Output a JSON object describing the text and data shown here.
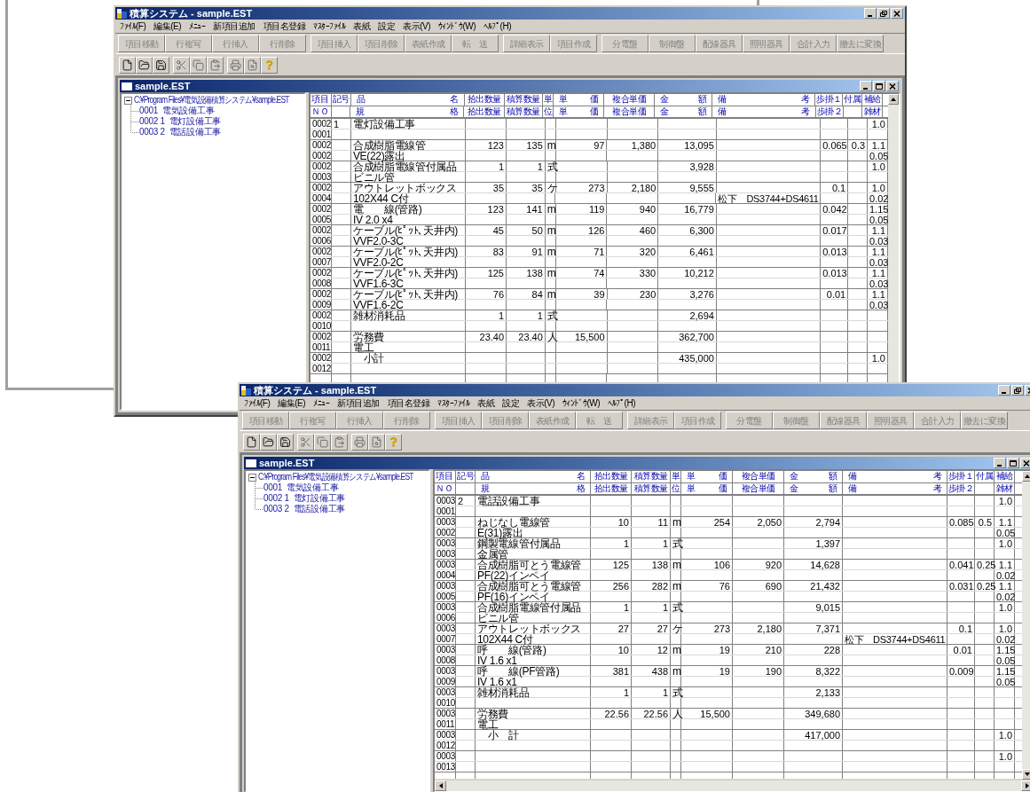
{
  "windows": [
    {
      "title": "積算システム - sample.EST",
      "menu": [
        "ﾌｧｲﾙ(F)",
        "編集(E)",
        "ﾒﾆｭｰ",
        "新項目追加",
        "項目名登録",
        "ﾏｽﾀｰﾌｧｲﾙ",
        "表紙",
        "設定",
        "表示(V)",
        "ｳｨﾝﾄﾞｳ(W)",
        "ﾍﾙﾌﾟ(H)"
      ],
      "toolbar_groups": [
        [
          {
            "label": "項目移動",
            "disabled": true
          },
          {
            "label": "行複写",
            "disabled": true
          },
          {
            "label": "行挿入",
            "disabled": true
          },
          {
            "label": "行削除",
            "disabled": true
          }
        ],
        [
          {
            "label": "項目挿入",
            "disabled": true
          },
          {
            "label": "項目削除",
            "disabled": true
          },
          {
            "label": "表紙作成",
            "disabled": true
          },
          {
            "label": "転　送",
            "disabled": true
          }
        ],
        [
          {
            "label": "詳細表示",
            "disabled": true
          },
          {
            "label": "項目作成",
            "disabled": true
          }
        ],
        [
          {
            "label": "分電盤",
            "disabled": true
          },
          {
            "label": "制御盤",
            "disabled": true
          },
          {
            "label": "配線器具",
            "disabled": true
          },
          {
            "label": "照明器具",
            "disabled": true
          },
          {
            "label": "合計入力",
            "disabled": true
          },
          {
            "label": "撤去に変換",
            "disabled": true
          }
        ]
      ],
      "child": {
        "title": "sample.EST",
        "tree": {
          "label": "C:¥Program Files¥電気設備積算システム¥sample.EST",
          "expanded": true,
          "children": [
            {
              "code": "0001",
              "label": "電気設備工事"
            },
            {
              "code": "0002 1",
              "label": "電灯設備工事"
            },
            {
              "code": "0003 2",
              "label": "電話設備工事"
            }
          ]
        },
        "table": {
          "columns": [
            {
              "top": [
                "項目"
              ],
              "bottom": [
                "ＮＯ"
              ]
            },
            {
              "top": [
                "記号"
              ]
            },
            {
              "top": [
                "品",
                "名"
              ],
              "bottom": [
                "規",
                "格"
              ]
            },
            {
              "top": [
                "拾出数量"
              ],
              "bottom": [
                "拾出数量"
              ]
            },
            {
              "top": [
                "積算数量"
              ],
              "bottom": [
                "積算数量"
              ]
            },
            {
              "top": [
                "単"
              ],
              "bottom": [
                "位"
              ]
            },
            {
              "top": [
                "単",
                "価"
              ],
              "bottom": [
                "単",
                "価"
              ]
            },
            {
              "top": [
                "複合単価"
              ],
              "bottom": [
                "複合単価"
              ]
            },
            {
              "top": [
                "金",
                "額"
              ],
              "bottom": [
                "金",
                "額"
              ]
            },
            {
              "top": [
                "備",
                "考"
              ],
              "bottom": [
                "備",
                "考"
              ]
            },
            {
              "top": [
                "歩掛１"
              ],
              "bottom": [
                "歩掛２"
              ]
            },
            {
              "top": [
                "付属"
              ]
            },
            {
              "top": [
                "補給"
              ],
              "bottom": [
                "雑材"
              ]
            }
          ],
          "rows": [
            {
              "no": "0002",
              "mark": "1",
              "name": "電灯設備工事",
              "supply": "1.0"
            },
            {
              "no": "0001"
            },
            {
              "no": "0002",
              "name": "合成樹脂電線管",
              "qty_takeoff": "123",
              "qty_estimate": "135",
              "unit": "m",
              "unit_price": "97",
              "compound_price": "1,380",
              "amount": "13,095",
              "labor": "0.065",
              "accessory": "0.3",
              "supply": "1.1"
            },
            {
              "no": "0002",
              "name": "VE(22)露出",
              "supply": "0.05"
            },
            {
              "no": "0002",
              "name": "合成樹脂電線管付属品",
              "qty_takeoff": "1",
              "qty_estimate": "1",
              "unit": "式",
              "amount": "3,928",
              "supply": "1.0"
            },
            {
              "no": "0003",
              "name": "ビニル管"
            },
            {
              "no": "0002",
              "name": "アウトレットボックス",
              "qty_takeoff": "35",
              "qty_estimate": "35",
              "unit": "ケ",
              "unit_price": "273",
              "compound_price": "2,180",
              "amount": "9,555",
              "labor": "0.1",
              "supply": "1.0"
            },
            {
              "no": "0004",
              "name": "102X44 C付",
              "remarks": "松下　DS3744+DS4611",
              "supply": "0.02"
            },
            {
              "no": "0002",
              "name": "電　　線(管路)",
              "qty_takeoff": "123",
              "qty_estimate": "141",
              "unit": "m",
              "unit_price": "119",
              "compound_price": "940",
              "amount": "16,779",
              "labor": "0.042",
              "supply": "1.15"
            },
            {
              "no": "0005",
              "name": "IV 2.0 x4",
              "supply": "0.05"
            },
            {
              "no": "0002",
              "name": "ケーブル(ﾋﾟｯﾄ､天井内)",
              "qty_takeoff": "45",
              "qty_estimate": "50",
              "unit": "m",
              "unit_price": "126",
              "compound_price": "460",
              "amount": "6,300",
              "labor": "0.017",
              "supply": "1.1"
            },
            {
              "no": "0006",
              "name": "VVF2.0-3C",
              "supply": "0.03"
            },
            {
              "no": "0002",
              "name": "ケーブル(ﾋﾟｯﾄ､天井内)",
              "qty_takeoff": "83",
              "qty_estimate": "91",
              "unit": "m",
              "unit_price": "71",
              "compound_price": "320",
              "amount": "6,461",
              "labor": "0.013",
              "supply": "1.1"
            },
            {
              "no": "0007",
              "name": "VVF2.0-2C",
              "supply": "0.03"
            },
            {
              "no": "0002",
              "name": "ケーブル(ﾋﾟｯﾄ､天井内)",
              "qty_takeoff": "125",
              "qty_estimate": "138",
              "unit": "m",
              "unit_price": "74",
              "compound_price": "330",
              "amount": "10,212",
              "labor": "0.013",
              "supply": "1.1"
            },
            {
              "no": "0008",
              "name": "VVF1.6-3C",
              "supply": "0.03"
            },
            {
              "no": "0002",
              "name": "ケーブル(ﾋﾟｯﾄ､天井内)",
              "qty_takeoff": "76",
              "qty_estimate": "84",
              "unit": "m",
              "unit_price": "39",
              "compound_price": "230",
              "amount": "3,276",
              "labor": "0.01",
              "supply": "1.1"
            },
            {
              "no": "0009",
              "name": "VVF1.6-2C",
              "supply": "0.03"
            },
            {
              "no": "0002",
              "name": "雑材消耗品",
              "qty_takeoff": "1",
              "qty_estimate": "1",
              "unit": "式",
              "amount": "2,694"
            },
            {
              "no": "0010"
            },
            {
              "no": "0002",
              "name": "労務費",
              "qty_takeoff": "23.40",
              "qty_estimate": "23.40",
              "unit": "人",
              "unit_price": "15,500",
              "amount": "362,700"
            },
            {
              "no": "0011",
              "name": "電工"
            },
            {
              "no": "0002",
              "name": "　小計",
              "amount": "435,000",
              "supply": "1.0"
            },
            {
              "no": "0012"
            }
          ]
        }
      }
    },
    {
      "title": "積算システム - sample.EST",
      "menu": [
        "ﾌｧｲﾙ(F)",
        "編集(E)",
        "ﾒﾆｭｰ",
        "新項目追加",
        "項目名登録",
        "ﾏｽﾀｰﾌｧｲﾙ",
        "表紙",
        "設定",
        "表示(V)",
        "ｳｨﾝﾄﾞｳ(W)",
        "ﾍﾙﾌﾟ(H)"
      ],
      "toolbar_groups": [
        [
          {
            "label": "項目移動",
            "disabled": true
          },
          {
            "label": "行複写",
            "disabled": true
          },
          {
            "label": "行挿入",
            "disabled": true
          },
          {
            "label": "行削除",
            "disabled": true
          }
        ],
        [
          {
            "label": "項目挿入",
            "disabled": true
          },
          {
            "label": "項目削除",
            "disabled": true
          },
          {
            "label": "表紙作成",
            "disabled": true
          },
          {
            "label": "転　送",
            "disabled": true
          }
        ],
        [
          {
            "label": "詳細表示",
            "disabled": true
          },
          {
            "label": "項目作成",
            "disabled": true
          }
        ],
        [
          {
            "label": "分電盤",
            "disabled": true
          },
          {
            "label": "制御盤",
            "disabled": true
          },
          {
            "label": "配線器具",
            "disabled": true
          },
          {
            "label": "照明器具",
            "disabled": true
          },
          {
            "label": "合計入力",
            "disabled": true
          },
          {
            "label": "撤去に変換",
            "disabled": true
          }
        ]
      ],
      "child": {
        "title": "sample.EST",
        "tree": {
          "label": "C:¥Program Files¥電気設備積算システム¥sample.EST",
          "expanded": true,
          "children": [
            {
              "code": "0001",
              "label": "電気設備工事"
            },
            {
              "code": "0002 1",
              "label": "電灯設備工事"
            },
            {
              "code": "0003 2",
              "label": "電話設備工事"
            }
          ]
        },
        "table": {
          "columns": [
            {
              "top": [
                "項目"
              ],
              "bottom": [
                "ＮＯ"
              ]
            },
            {
              "top": [
                "記号"
              ]
            },
            {
              "top": [
                "品",
                "名"
              ],
              "bottom": [
                "規",
                "格"
              ]
            },
            {
              "top": [
                "拾出数量"
              ],
              "bottom": [
                "拾出数量"
              ]
            },
            {
              "top": [
                "積算数量"
              ],
              "bottom": [
                "積算数量"
              ]
            },
            {
              "top": [
                "単"
              ],
              "bottom": [
                "位"
              ]
            },
            {
              "top": [
                "単",
                "価"
              ],
              "bottom": [
                "単",
                "価"
              ]
            },
            {
              "top": [
                "複合単価"
              ],
              "bottom": [
                "複合単価"
              ]
            },
            {
              "top": [
                "金",
                "額"
              ],
              "bottom": [
                "金",
                "額"
              ]
            },
            {
              "top": [
                "備",
                "考"
              ],
              "bottom": [
                "備",
                "考"
              ]
            },
            {
              "top": [
                "歩掛１"
              ],
              "bottom": [
                "歩掛２"
              ]
            },
            {
              "top": [
                "付属"
              ]
            },
            {
              "top": [
                "補給"
              ],
              "bottom": [
                "雑材"
              ]
            }
          ],
          "rows": [
            {
              "no": "0003",
              "mark": "2",
              "name": "電話設備工事",
              "supply": "1.0"
            },
            {
              "no": "0001"
            },
            {
              "no": "0003",
              "name": "ねじなし電線管",
              "qty_takeoff": "10",
              "qty_estimate": "11",
              "unit": "m",
              "unit_price": "254",
              "compound_price": "2,050",
              "amount": "2,794",
              "labor": "0.085",
              "accessory": "0.5",
              "supply": "1.1"
            },
            {
              "no": "0002",
              "name": "E(31)露出",
              "supply": "0.05"
            },
            {
              "no": "0003",
              "name": "鋼製電線管付属品",
              "qty_takeoff": "1",
              "qty_estimate": "1",
              "unit": "式",
              "amount": "1,397",
              "supply": "1.0"
            },
            {
              "no": "0003",
              "name": "金属管"
            },
            {
              "no": "0003",
              "name": "合成樹脂可とう電線管",
              "qty_takeoff": "125",
              "qty_estimate": "138",
              "unit": "m",
              "unit_price": "106",
              "compound_price": "920",
              "amount": "14,628",
              "labor": "0.041",
              "accessory": "0.25",
              "supply": "1.1"
            },
            {
              "no": "0004",
              "name": "PF(22)インペイ",
              "supply": "0.02"
            },
            {
              "no": "0003",
              "name": "合成樹脂可とう電線管",
              "qty_takeoff": "256",
              "qty_estimate": "282",
              "unit": "m",
              "unit_price": "76",
              "compound_price": "690",
              "amount": "21,432",
              "labor": "0.031",
              "accessory": "0.25",
              "supply": "1.1"
            },
            {
              "no": "0005",
              "name": "PF(16)インペイ",
              "supply": "0.02"
            },
            {
              "no": "0003",
              "name": "合成樹脂電線管付属品",
              "qty_takeoff": "1",
              "qty_estimate": "1",
              "unit": "式",
              "amount": "9,015",
              "supply": "1.0"
            },
            {
              "no": "0006",
              "name": "ビニル管"
            },
            {
              "no": "0003",
              "name": "アウトレットボックス",
              "qty_takeoff": "27",
              "qty_estimate": "27",
              "unit": "ケ",
              "unit_price": "273",
              "compound_price": "2,180",
              "amount": "7,371",
              "labor": "0.1",
              "supply": "1.0"
            },
            {
              "no": "0007",
              "name": "102X44 C付",
              "remarks": "松下　DS3744+DS4611",
              "supply": "0.02"
            },
            {
              "no": "0003",
              "name": "呼　　線(管路)",
              "qty_takeoff": "10",
              "qty_estimate": "12",
              "unit": "m",
              "unit_price": "19",
              "compound_price": "210",
              "amount": "228",
              "labor": "0.01",
              "supply": "1.15"
            },
            {
              "no": "0008",
              "name": "IV 1.6 x1",
              "supply": "0.05"
            },
            {
              "no": "0003",
              "name": "呼　　線(PF管路)",
              "qty_takeoff": "381",
              "qty_estimate": "438",
              "unit": "m",
              "unit_price": "19",
              "compound_price": "190",
              "amount": "8,322",
              "labor": "0.009",
              "supply": "1.15"
            },
            {
              "no": "0009",
              "name": "IV 1.6 x1",
              "supply": "0.05"
            },
            {
              "no": "0003",
              "name": "雑材消耗品",
              "qty_takeoff": "1",
              "qty_estimate": "1",
              "unit": "式",
              "amount": "2,133"
            },
            {
              "no": "0010"
            },
            {
              "no": "0003",
              "name": "労務費",
              "qty_takeoff": "22.56",
              "qty_estimate": "22.56",
              "unit": "人",
              "unit_price": "15,500",
              "amount": "349,680"
            },
            {
              "no": "0011",
              "name": "電工"
            },
            {
              "no": "0003",
              "name": "　小　計",
              "amount": "417,000",
              "supply": "1.0"
            },
            {
              "no": "0012"
            },
            {
              "no": "0003",
              "supply": "1.0"
            },
            {
              "no": "0013"
            }
          ]
        }
      }
    }
  ]
}
